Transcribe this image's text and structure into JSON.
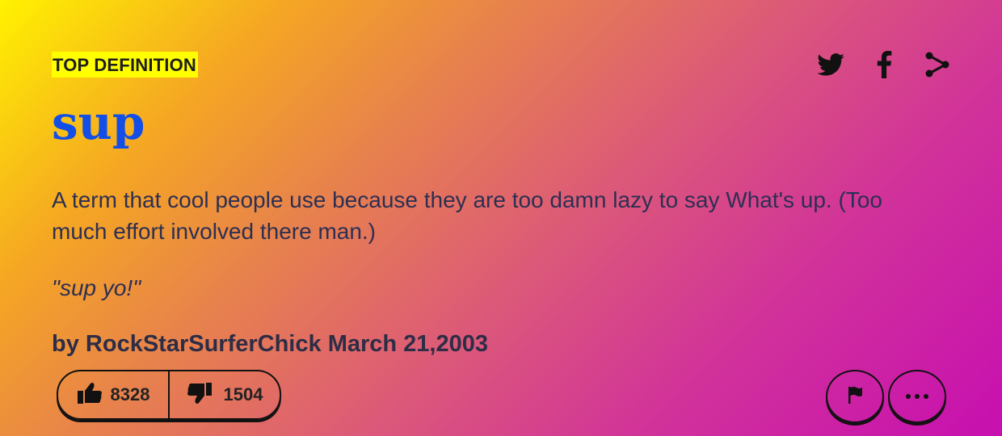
{
  "header": {
    "label": "TOP DEFINITION"
  },
  "entry": {
    "word": "sup",
    "meaning": "A term that cool people use because they are too damn lazy to say What's up. (Too much effort involved there man.)",
    "example": "\"sup yo!\"",
    "by_prefix": "by",
    "author": "RockStarSurferChick",
    "date": "March 21,2003"
  },
  "share": {
    "icons": [
      "twitter-icon",
      "facebook-icon",
      "share-icon"
    ]
  },
  "votes": {
    "up": "8328",
    "down": "1504"
  },
  "actions": {
    "flag_icon": "flag-icon",
    "more_icon": "more-icon"
  },
  "colors": {
    "word": "#134fe6",
    "label_highlight": "#ffff00",
    "gradient_start": "#fff200",
    "gradient_end": "#c70fb0"
  }
}
